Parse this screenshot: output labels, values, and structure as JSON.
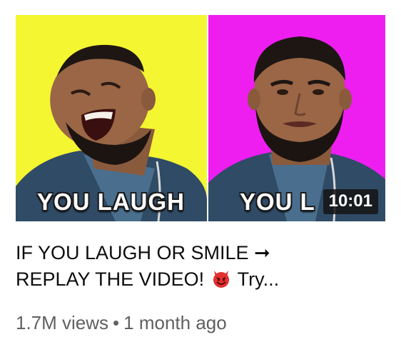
{
  "thumbnail": {
    "left_caption": "YOU LAUGH",
    "right_caption": "YOU L",
    "duration": "10:01",
    "left_bg_color": "#f4f631",
    "right_bg_color": "#ee1ef0"
  },
  "video": {
    "title_line1": "IF YOU LAUGH OR SMILE ➞",
    "title_line2_a": "REPLAY THE VIDEO!",
    "title_line2_b": "Try...",
    "title_emoji_icon": "smiling-devil-icon",
    "views": "1.7M views",
    "separator": "•",
    "age": "1 month ago"
  }
}
